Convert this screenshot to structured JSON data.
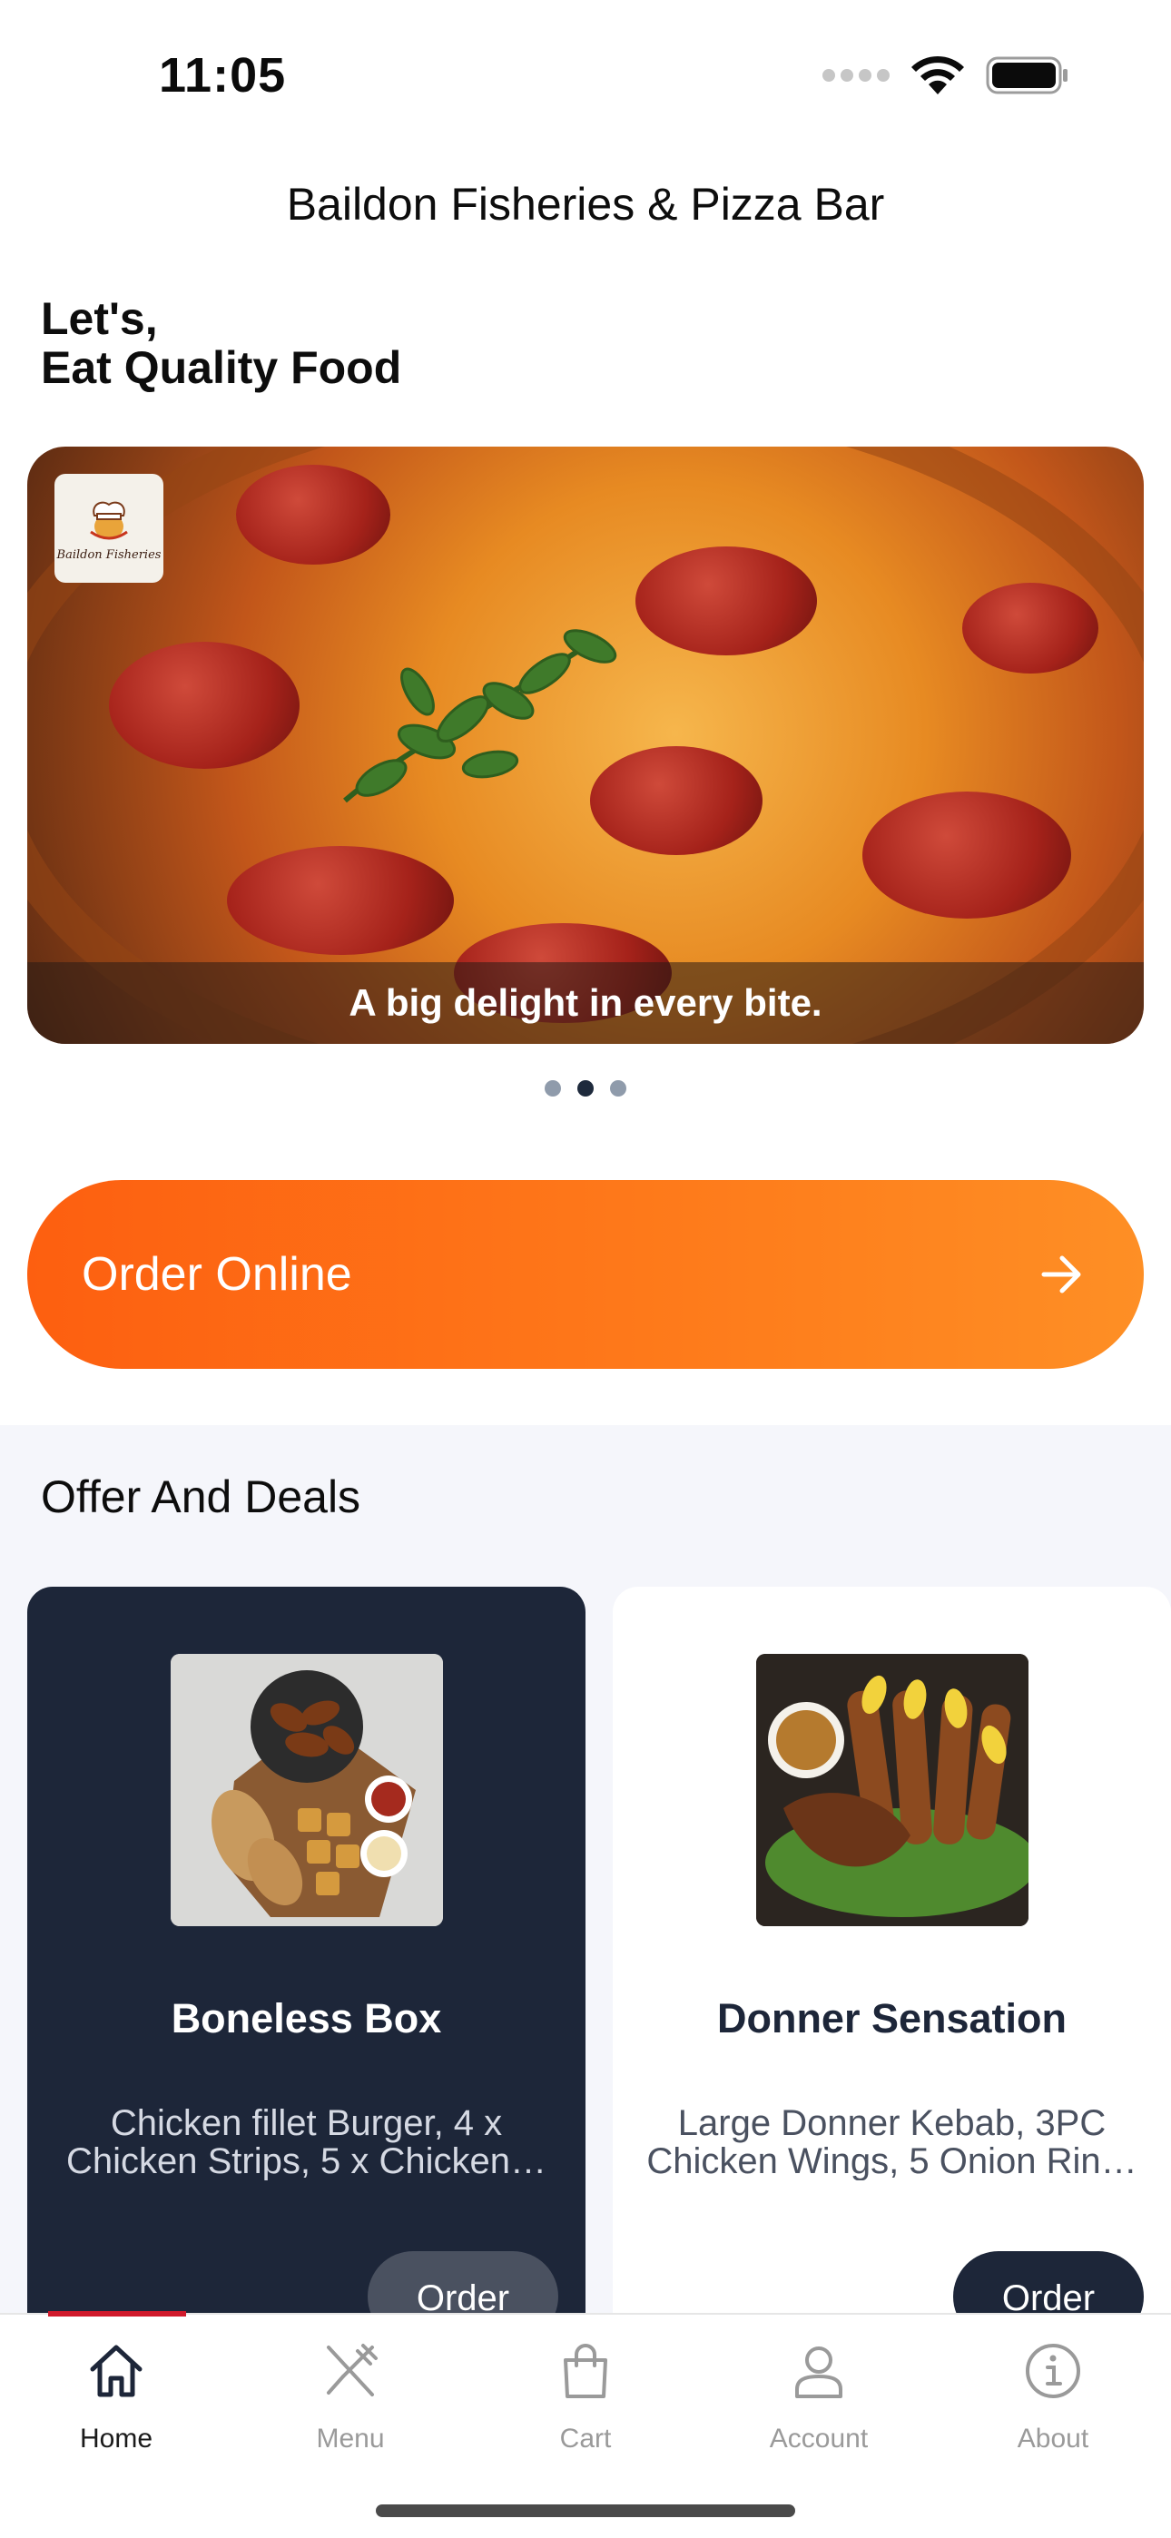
{
  "status_bar": {
    "time": "11:05",
    "icons": [
      "signal-dots-icon",
      "wifi-icon",
      "battery-icon"
    ]
  },
  "header": {
    "title": "Baildon Fisheries & Pizza Bar"
  },
  "greeting": {
    "line1": "Let's,",
    "line2": "Eat Quality Food"
  },
  "hero": {
    "caption": "A big delight in every bite.",
    "logo_text": "Baildon Fisheries",
    "slide_count": 3,
    "active_slide": 2
  },
  "order_online": {
    "label": "Order Online",
    "icon": "arrow-right-icon"
  },
  "offers": {
    "title": "Offer And Deals",
    "deals": [
      {
        "name": "Boneless Box",
        "description": "Chicken fillet Burger, 4 x Chicken Strips, 5 x Chicken…",
        "button": "Order"
      },
      {
        "name": "Donner Sensation",
        "description": "Large Donner Kebab, 3PC Chicken Wings, 5 Onion Rin…",
        "button": "Order"
      }
    ]
  },
  "tab_bar": {
    "tabs": [
      {
        "label": "Home",
        "icon": "home-icon",
        "active": true
      },
      {
        "label": "Menu",
        "icon": "fork-knife-icon",
        "active": false
      },
      {
        "label": "Cart",
        "icon": "shopping-bag-icon",
        "active": false
      },
      {
        "label": "Account",
        "icon": "user-icon",
        "active": false
      },
      {
        "label": "About",
        "icon": "info-icon",
        "active": false
      }
    ]
  },
  "colors": {
    "accent_orange": "#fd6a14",
    "navy": "#1d2639",
    "active_tab_indicator": "#d0192b"
  }
}
